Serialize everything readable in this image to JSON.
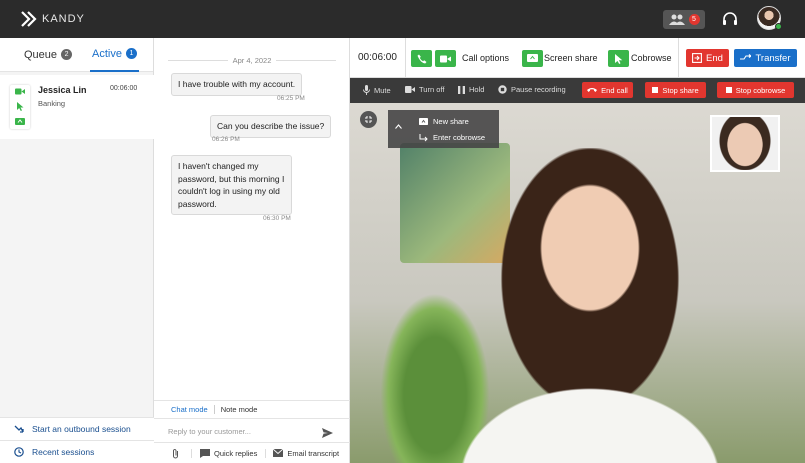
{
  "app": {
    "brand": "KANDY",
    "users_count": "5",
    "colors": {
      "topbar": "#2b2b2b",
      "accent_blue": "#1a6fc9",
      "accent_green": "#3ab54a",
      "danger_red": "#e2362f"
    }
  },
  "left": {
    "tabs": [
      {
        "label": "Queue",
        "count": "2"
      },
      {
        "label": "Active",
        "count": "1"
      }
    ],
    "session": {
      "name": "Jessica Lin",
      "subtitle": "Banking",
      "time": "00:06:00",
      "icons": [
        "video-icon",
        "cursor-icon",
        "screen-icon"
      ]
    },
    "footer": {
      "outbound": "Start an outbound session",
      "recent": "Recent sessions"
    }
  },
  "chat": {
    "date": "Apr 4, 2022",
    "messages": [
      {
        "text": "I have trouble with my account.",
        "time": "06:25 PM"
      },
      {
        "text": "Can you describe the issue?",
        "time": "06:26 PM"
      },
      {
        "text": "I haven't changed my password, but this morning I couldn't log in using my old password.",
        "time": "06:30 PM"
      }
    ],
    "modes": {
      "chat": "Chat mode",
      "note": "Note mode"
    },
    "reply_placeholder": "Reply to your customer...",
    "tools": {
      "quick_replies": "Quick replies",
      "email_transcript": "Email transcript"
    }
  },
  "call": {
    "timer": "00:06:00",
    "call_options": "Call options",
    "screen_share": "Screen share",
    "cobrowse": "Cobrowse",
    "end": "End",
    "transfer": "Transfer",
    "controls": {
      "mute": "Mute",
      "turn_off": "Turn off",
      "hold": "Hold",
      "pause_recording": "Pause recording",
      "end_call": "End call",
      "stop_share": "Stop share",
      "stop_cobrowse": "Stop cobrowse"
    },
    "share_menu": {
      "new_share": "New share",
      "enter_cobrowse": "Enter cobrowse"
    }
  }
}
